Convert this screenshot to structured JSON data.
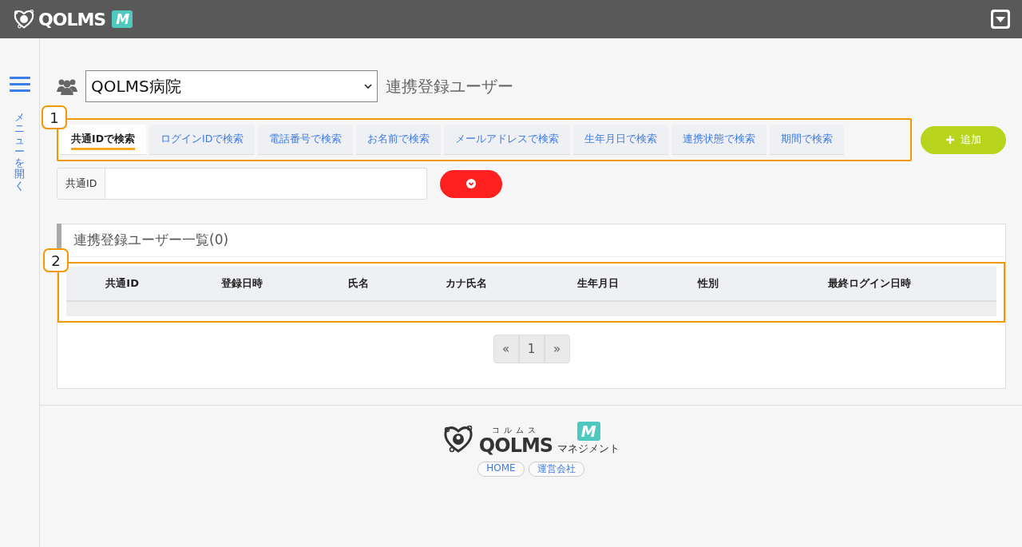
{
  "topbar": {
    "logo": "QOLMS",
    "logo_badge": "M"
  },
  "sidebar": {
    "menu_label": "メニューを開く"
  },
  "header": {
    "facility": "QOLMS病院",
    "title": "連携登録ユーザー"
  },
  "search": {
    "callout": "1",
    "tabs": [
      {
        "label": "共通IDで検索",
        "selected": true
      },
      {
        "label": "ログインIDで検索",
        "selected": false
      },
      {
        "label": "電話番号で検索",
        "selected": false
      },
      {
        "label": "お名前で検索",
        "selected": false
      },
      {
        "label": "メールアドレスで検索",
        "selected": false
      },
      {
        "label": "生年月日で検索",
        "selected": false
      },
      {
        "label": "連携状態で検索",
        "selected": false
      },
      {
        "label": "期間で検索",
        "selected": false
      }
    ],
    "add_button": "追加",
    "field_label": "共通ID"
  },
  "results": {
    "title": "連携登録ユーザー一覧(0)",
    "callout": "2",
    "columns": [
      "共通ID",
      "登録日時",
      "氏名",
      "カナ氏名",
      "生年月日",
      "性別",
      "最終ログイン日時"
    ],
    "pagination": {
      "prev": "«",
      "pages": [
        "1"
      ],
      "next": "»"
    }
  },
  "footer": {
    "logo_ruby": "コルムス",
    "logo": "QOLMS",
    "logo_badge": "M",
    "logo_sub": "マネジメント",
    "links": [
      "HOME",
      "運営会社"
    ]
  }
}
